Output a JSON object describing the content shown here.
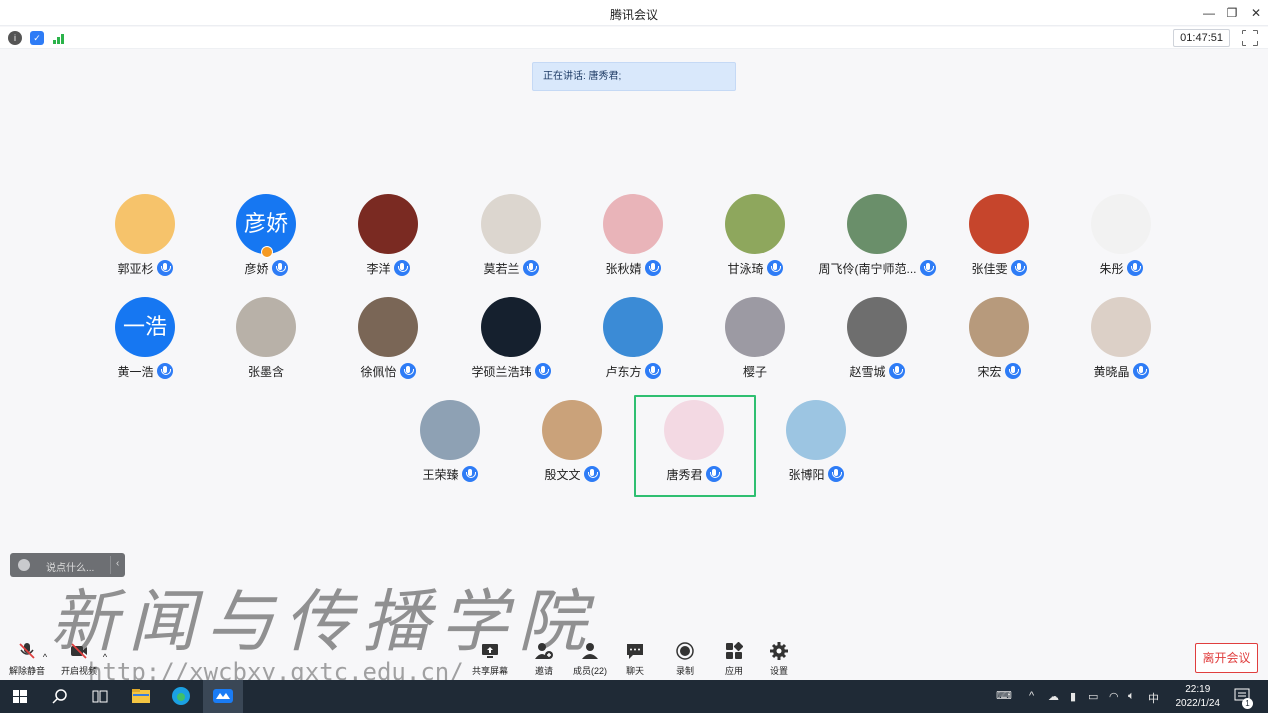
{
  "window": {
    "title": "腾讯会议"
  },
  "infobar": {
    "timer": "01:47:51"
  },
  "speaking": {
    "text": "正在讲话: 唐秀君;"
  },
  "participants": [
    {
      "name": "郭亚杉",
      "color": "#f6c36b"
    },
    {
      "name": "彦娇",
      "avatar_text": "彦娇",
      "color": "#1677f2"
    },
    {
      "name": "李洋",
      "color": "#7a2a22"
    },
    {
      "name": "莫若兰",
      "color": "#dcd6cf"
    },
    {
      "name": "张秋婧",
      "color": "#e9b4b9"
    },
    {
      "name": "甘泳琦",
      "color": "#8ea75d"
    },
    {
      "name": "周飞伶(南宁师范...",
      "color": "#6a8f6a"
    },
    {
      "name": "张佳雯",
      "color": "#c6452c"
    },
    {
      "name": "朱彤",
      "color": "#f2f2f2"
    },
    {
      "name": "黄一浩",
      "avatar_text": "一浩",
      "color": "#1677f2"
    },
    {
      "name": "张墨含",
      "color": "#b8b1a8"
    },
    {
      "name": "徐佩怡",
      "color": "#7a6656"
    },
    {
      "name": "学硕兰浩玮",
      "color": "#15202e"
    },
    {
      "name": "卢东方",
      "color": "#3b8bd6"
    },
    {
      "name": "樱子",
      "color": "#9c9aa3"
    },
    {
      "name": "赵雪城",
      "color": "#6e6e6e"
    },
    {
      "name": "宋宏",
      "color": "#b79a7c"
    },
    {
      "name": "黄晓晶",
      "color": "#dcd0c7"
    },
    {
      "name": "王荣臻",
      "color": "#8ea1b4"
    },
    {
      "name": "殷文文",
      "color": "#caa27a"
    },
    {
      "name": "唐秀君",
      "color": "#f3d9e3"
    },
    {
      "name": "张博阳",
      "color": "#9cc5e2"
    }
  ],
  "chat": {
    "placeholder": "说点什么..."
  },
  "watermark": {
    "title": "新闻与传播学院",
    "url": "http://xwcbxy.gxtc.edu.cn/"
  },
  "toolbar": {
    "unmute": "解除静音",
    "video": "开启视频",
    "share": "共享屏幕",
    "invite": "邀请",
    "members": "成员(22)",
    "chat": "聊天",
    "record": "录制",
    "apps": "应用",
    "settings": "设置",
    "leave": "离开会议"
  },
  "taskbar": {
    "time": "22:19",
    "date": "2022/1/24",
    "ime": "中",
    "notifications": "1"
  }
}
